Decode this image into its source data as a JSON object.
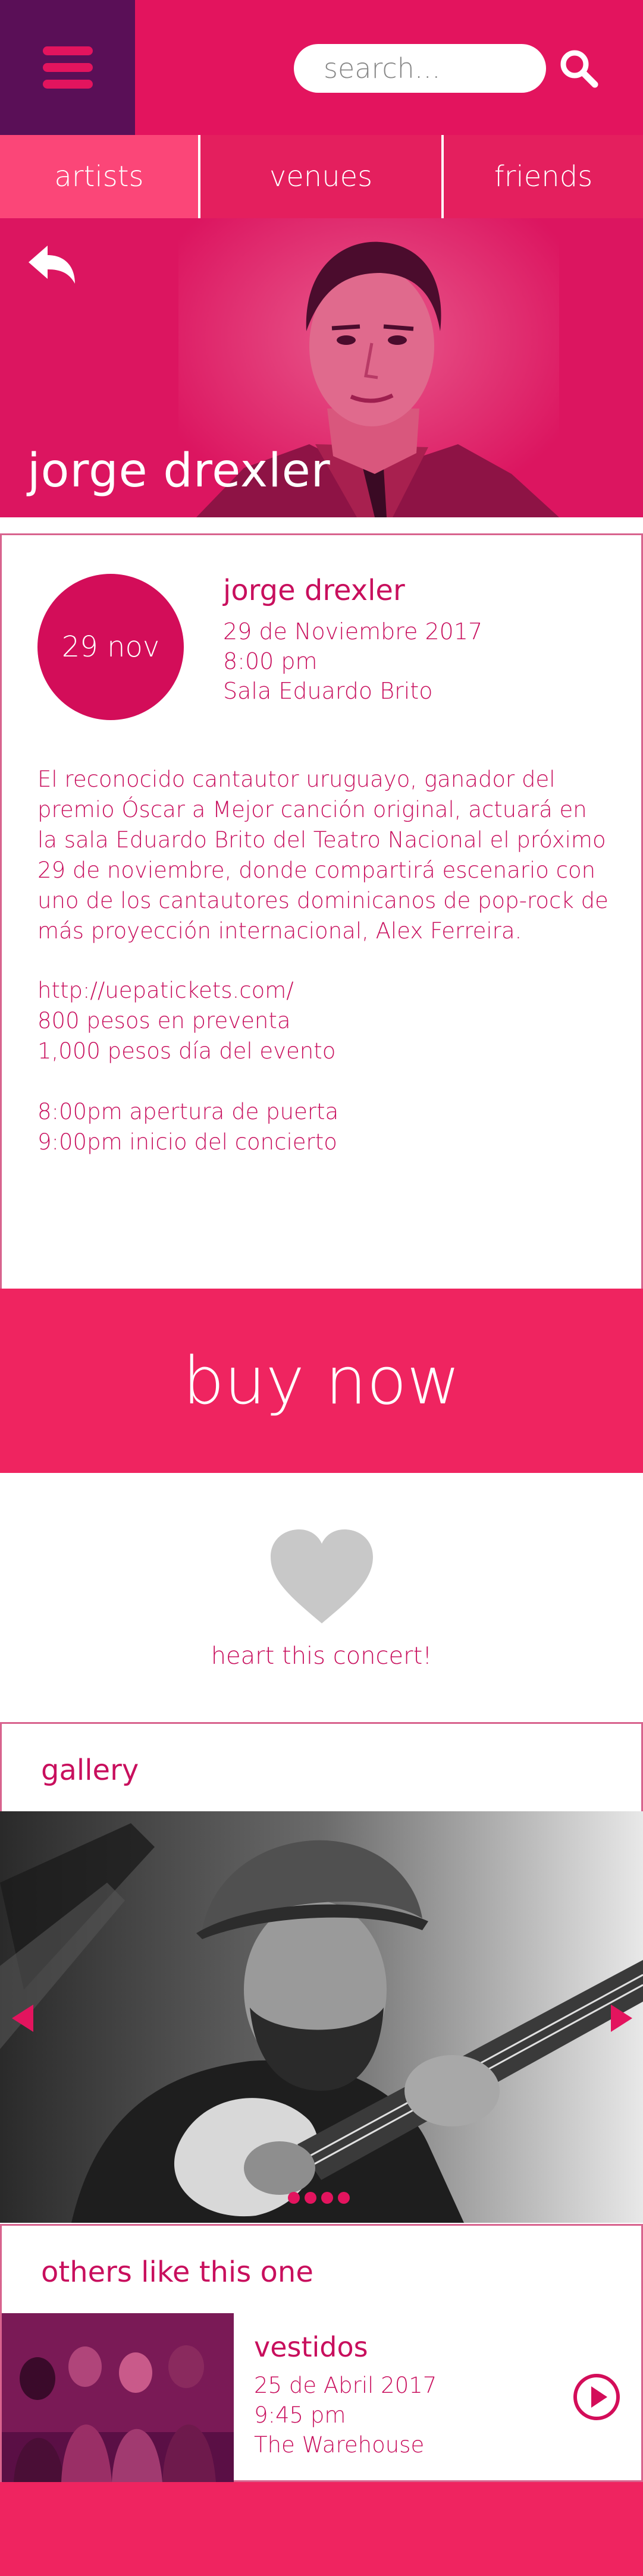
{
  "header": {
    "search_placeholder": "search...",
    "icons": {
      "menu": "hamburger-icon",
      "search": "search-icon"
    },
    "colors": {
      "header_bg": "#e3145e",
      "menu_bg": "#5a0f57"
    }
  },
  "tabs": [
    {
      "label": "artists"
    },
    {
      "label": "venues"
    },
    {
      "label": "friends"
    }
  ],
  "hero": {
    "title": "jorge drexler",
    "back_icon": "back-arrow-icon"
  },
  "event": {
    "date_badge": "29 nov",
    "name": "jorge drexler",
    "date": "29 de Noviembre 2017",
    "time": "8:00 pm",
    "venue": "Sala Eduardo Brito",
    "description": "El reconocido cantautor uruguayo, ganador del premio Óscar a Mejor canción original, actuará en la sala Eduardo Brito del Teatro Nacional  el próximo 29 de noviembre, donde compartirá escenario con uno de los cantautores dominicanos de pop-rock de más proyección internacional, Alex Ferreira.",
    "ticket_url": "http://uepatickets.com/",
    "price_presale": "800 pesos en preventa",
    "price_door": "1,000 pesos día del evento",
    "doors_open": "8:00pm apertura de puerta",
    "show_start": "9:00pm inicio del concierto"
  },
  "buy": {
    "label": "buy now",
    "color": "#ef2460"
  },
  "heart": {
    "label": "heart this concert!",
    "icon": "heart-icon",
    "color": "#c8c8c8"
  },
  "gallery": {
    "title": "gallery",
    "active_index": 0,
    "count": 4
  },
  "others": {
    "title": "others like this one",
    "items": [
      {
        "name": "vestidos",
        "date": "25 de Abril 2017",
        "time": "9:45 pm",
        "venue": "The Warehouse"
      }
    ]
  }
}
